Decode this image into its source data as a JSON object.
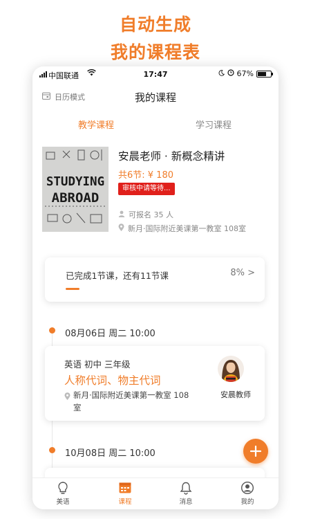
{
  "promo": {
    "line1": "自动生成",
    "line2": "我的课程表"
  },
  "status_bar": {
    "carrier": "中国联通",
    "time": "17:47",
    "battery": "67%",
    "battery_level": 0.67
  },
  "nav": {
    "calendar_mode": "日历模式",
    "title": "我的课程"
  },
  "tabs": [
    {
      "label": "教学课程",
      "active": true
    },
    {
      "label": "学习课程",
      "active": false
    }
  ],
  "course": {
    "thumbnail_text": [
      "STUDYING",
      "ABROAD"
    ],
    "name": "安晨老师 · 新概念精讲",
    "price": "共6节: ¥ 180",
    "status_badge": "审核中请等待...",
    "enroll": "可报名 35 人",
    "location": "新月·国际附近美课第一教室 108室"
  },
  "progress": {
    "text": "已完成1节课，还有11节课",
    "percent_text": "8% >",
    "percent": 8
  },
  "schedule": [
    {
      "date": "08月06日 周二 10:00",
      "subject": "英语 初中 三年级",
      "title": "人称代词、物主代词",
      "location": "新月·国际附近美课第一教室 108室",
      "teacher": "安晨教师"
    },
    {
      "date": "10月08日 周二 10:00"
    }
  ],
  "tab_bar": [
    {
      "label": "美语",
      "icon": "lightbulb-icon",
      "active": false
    },
    {
      "label": "课程",
      "icon": "calendar-icon",
      "active": true
    },
    {
      "label": "消息",
      "icon": "bell-icon",
      "active": false
    },
    {
      "label": "我的",
      "icon": "user-icon",
      "active": false
    }
  ],
  "colors": {
    "accent": "#f07d2a",
    "badge": "#e0201b"
  }
}
